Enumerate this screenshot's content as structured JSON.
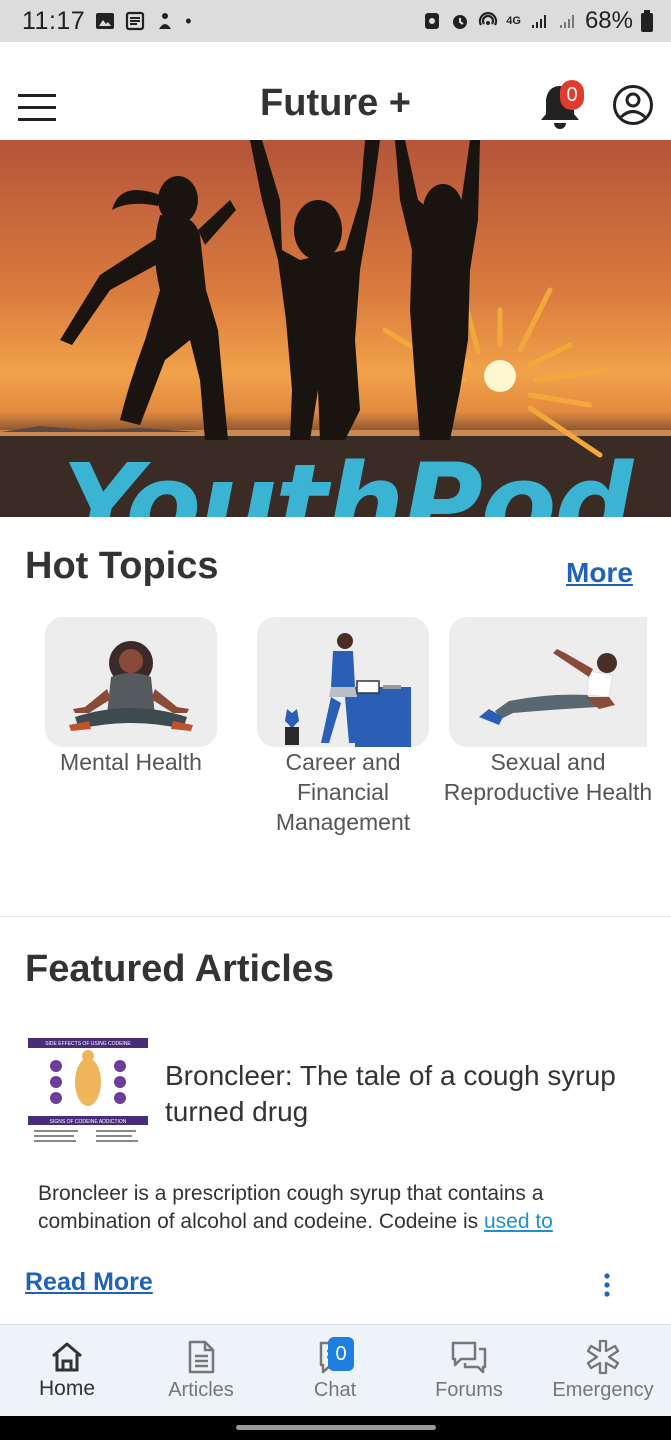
{
  "status_bar": {
    "time": "11:17",
    "battery": "68%",
    "network": "4G"
  },
  "header": {
    "title": "Future +",
    "notification_count": "0"
  },
  "hero": {
    "brand_text": "YouthPod"
  },
  "hot_topics": {
    "title": "Hot Topics",
    "more_label": "More",
    "topics": [
      {
        "label": "Mental Health"
      },
      {
        "label": "Career and Financial Management"
      },
      {
        "label": "Sexual and Reproductive Health"
      }
    ]
  },
  "featured": {
    "title": "Featured Articles",
    "article": {
      "title": "Broncleer: The tale of a cough syrup turned drug",
      "excerpt": "Broncleer is a prescription cough syrup that contains a combination of alcohol and codeine. Codeine is ",
      "excerpt_link": "used to",
      "read_more": "Read More",
      "thumb_heading": "SIDE EFFECTS OF USING CODEINE",
      "thumb_subheading": "SIGNS OF CODEINE ADDICTION"
    }
  },
  "bottom_nav": {
    "items": [
      {
        "label": "Home",
        "icon": "home-icon"
      },
      {
        "label": "Articles",
        "icon": "document-icon"
      },
      {
        "label": "Chat",
        "icon": "chat-icon"
      },
      {
        "label": "Forums",
        "icon": "forums-icon"
      },
      {
        "label": "Emergency",
        "icon": "emergency-icon"
      }
    ],
    "chat_badge": "0"
  },
  "colors": {
    "accent_link": "#1e63b8",
    "badge_red": "#e23b2e",
    "badge_blue": "#1e7fe0",
    "hero_text": "#3bb4d4"
  }
}
